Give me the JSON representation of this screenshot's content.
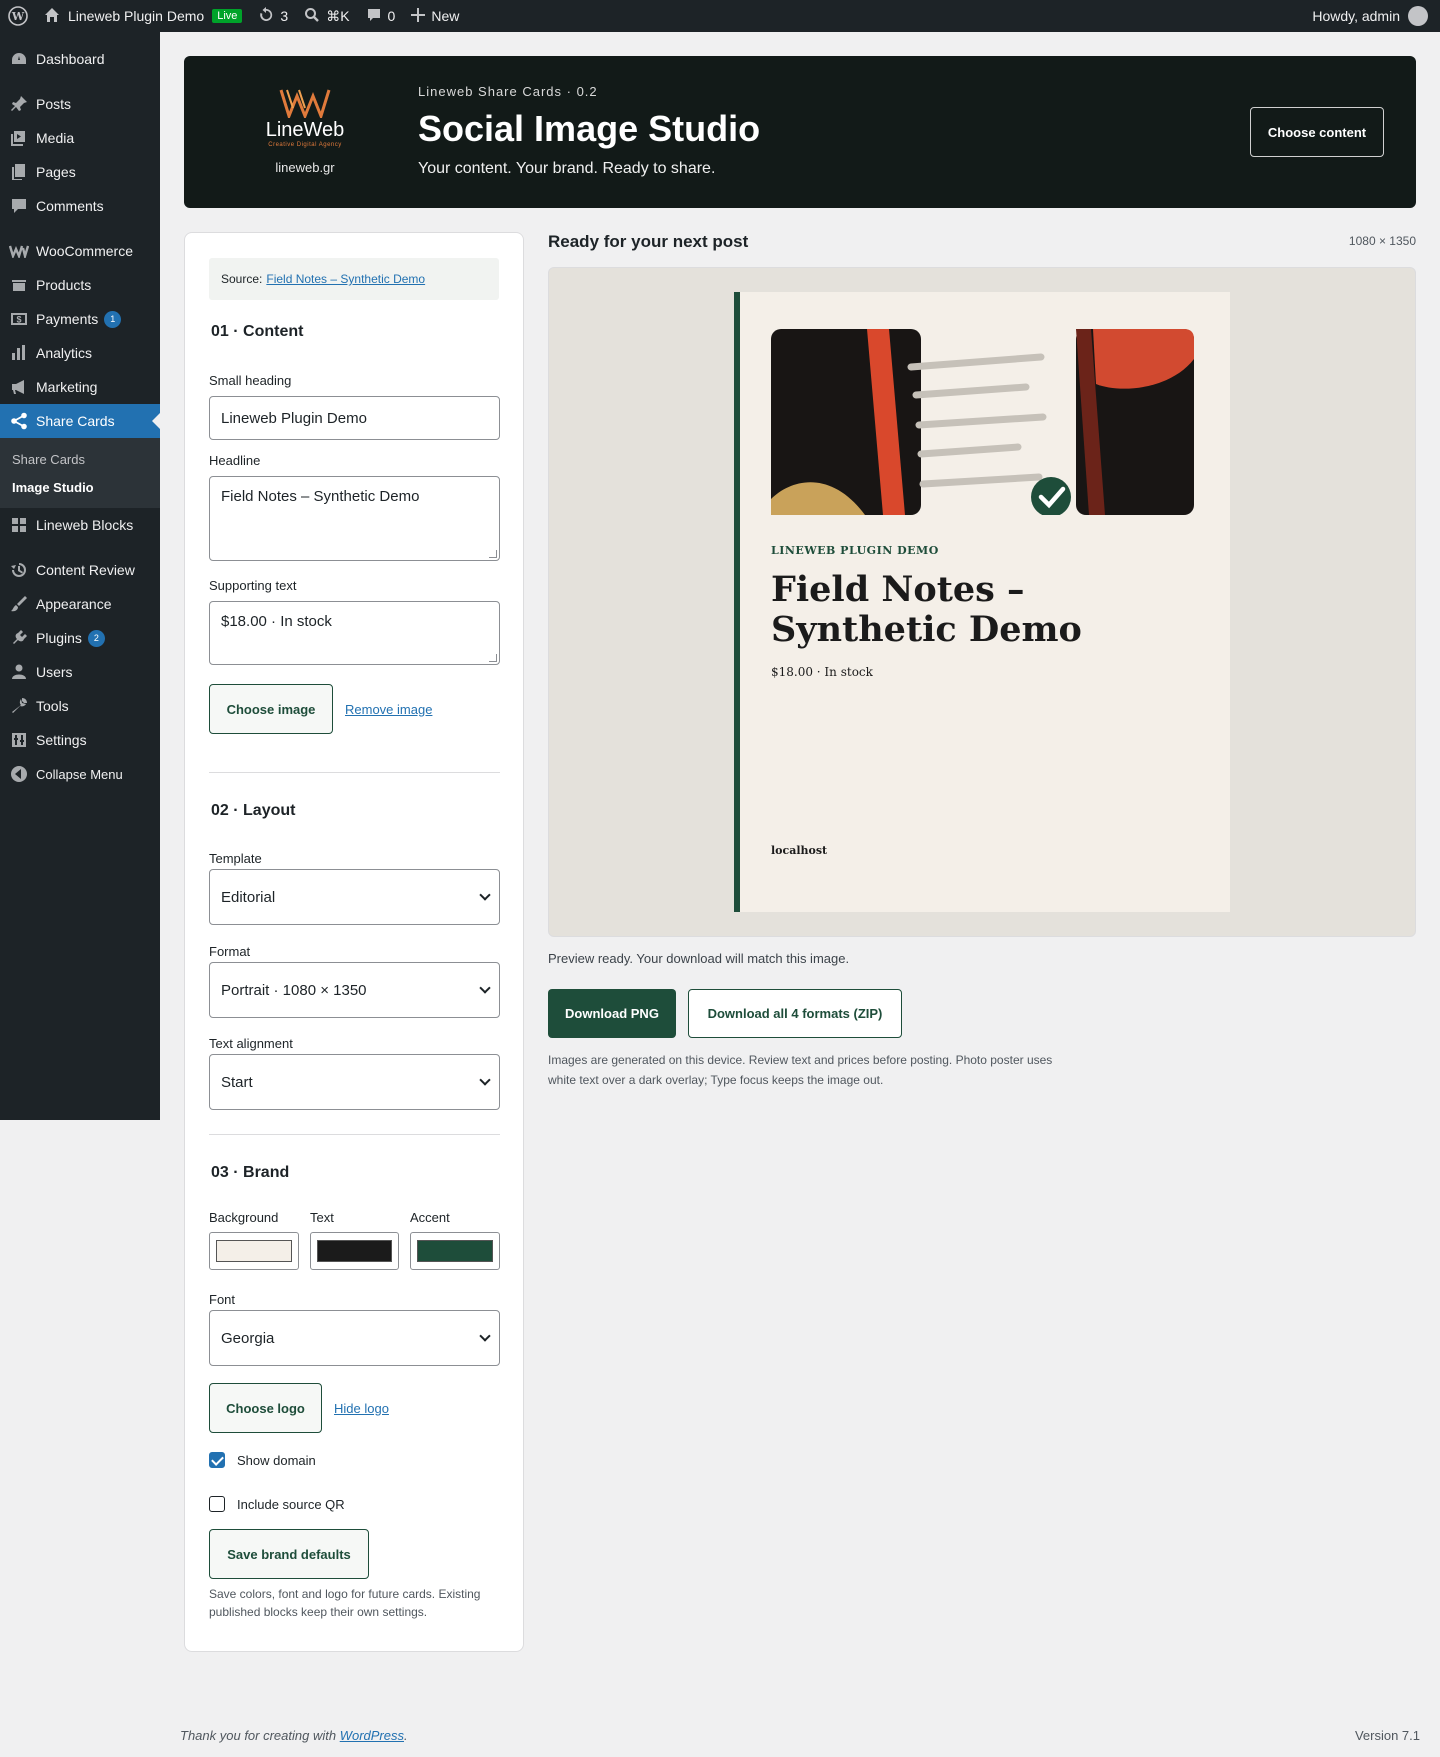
{
  "adminbar": {
    "site_name": "Lineweb Plugin Demo",
    "live_label": "Live",
    "updates_count": "3",
    "search_shortcut": "⌘K",
    "comments_count": "0",
    "new_label": "New",
    "greeting": "Howdy, admin"
  },
  "sidebar": {
    "items": [
      {
        "label": "Dashboard",
        "icon": "dashboard-icon"
      },
      {
        "label": "Posts",
        "icon": "pin-icon"
      },
      {
        "label": "Media",
        "icon": "media-icon"
      },
      {
        "label": "Pages",
        "icon": "pages-icon"
      },
      {
        "label": "Comments",
        "icon": "comments-icon"
      },
      {
        "label": "WooCommerce",
        "icon": "woocommerce-icon"
      },
      {
        "label": "Products",
        "icon": "products-icon"
      },
      {
        "label": "Payments",
        "icon": "payments-icon",
        "badge": "1"
      },
      {
        "label": "Analytics",
        "icon": "analytics-icon"
      },
      {
        "label": "Marketing",
        "icon": "megaphone-icon"
      },
      {
        "label": "Share Cards",
        "icon": "share-icon"
      },
      {
        "label": "Lineweb Blocks",
        "icon": "blocks-icon"
      },
      {
        "label": "Content Review",
        "icon": "history-icon"
      },
      {
        "label": "Appearance",
        "icon": "brush-icon"
      },
      {
        "label": "Plugins",
        "icon": "plugin-icon",
        "badge": "2"
      },
      {
        "label": "Users",
        "icon": "user-icon"
      },
      {
        "label": "Tools",
        "icon": "wrench-icon"
      },
      {
        "label": "Settings",
        "icon": "settings-icon"
      },
      {
        "label": "Collapse Menu",
        "icon": "collapse-icon"
      }
    ],
    "submenu": [
      "Share Cards",
      "Image Studio"
    ]
  },
  "hero": {
    "logo_word": "LineWeb",
    "logo_tagline": "Creative Digital Agency",
    "domain": "lineweb.gr",
    "eyebrow": "Lineweb Share Cards · 0.2",
    "title": "Social Image Studio",
    "tagline": "Your content. Your brand. Ready to share.",
    "choose_content": "Choose content"
  },
  "panel": {
    "source_label": "Source:",
    "source_link": "Field Notes – Synthetic Demo",
    "content_title": "01 · Content",
    "small_heading_label": "Small heading",
    "small_heading_value": "Lineweb Plugin Demo",
    "headline_label": "Headline",
    "headline_value": "Field Notes – Synthetic Demo",
    "supporting_label": "Supporting text",
    "supporting_value": "$18.00 · In stock",
    "choose_image": "Choose image",
    "remove_image": "Remove image",
    "layout_title": "02 · Layout",
    "template_label": "Template",
    "template_value": "Editorial",
    "format_label": "Format",
    "format_value": "Portrait · 1080 × 1350",
    "alignment_label": "Text alignment",
    "alignment_value": "Start",
    "brand_title": "03 · Brand",
    "bg_label": "Background",
    "text_label": "Text",
    "accent_label": "Accent",
    "bg_color": "#f4efe8",
    "text_color": "#1b1b1b",
    "accent_color": "#1e4d3a",
    "font_label": "Font",
    "font_value": "Georgia",
    "choose_logo": "Choose logo",
    "hide_logo": "Hide logo",
    "show_domain_label": "Show domain",
    "show_domain_checked": true,
    "include_qr_label": "Include source QR",
    "include_qr_checked": false,
    "save_defaults": "Save brand defaults",
    "save_help": "Save colors, font and logo for future cards. Existing published blocks keep their own settings."
  },
  "preview": {
    "title": "Ready for your next post",
    "dims": "1080 × 1350",
    "card_eyebrow": "LINEWEB PLUGIN DEMO",
    "card_headline": "Field Notes – Synthetic Demo",
    "card_support": "$18.00 · In stock",
    "card_domain": "localhost",
    "status": "Preview ready. Your download will match this image.",
    "download_png": "Download PNG",
    "download_zip": "Download all 4 formats (ZIP)",
    "note": "Images are generated on this device. Review text and prices before posting. Photo poster uses white text over a dark overlay; Type focus keeps the image out."
  },
  "footer": {
    "thanks_prefix": "Thank you for creating with",
    "thanks_link": "WordPress",
    "thanks_suffix": ".",
    "version": "Version 7.1"
  }
}
